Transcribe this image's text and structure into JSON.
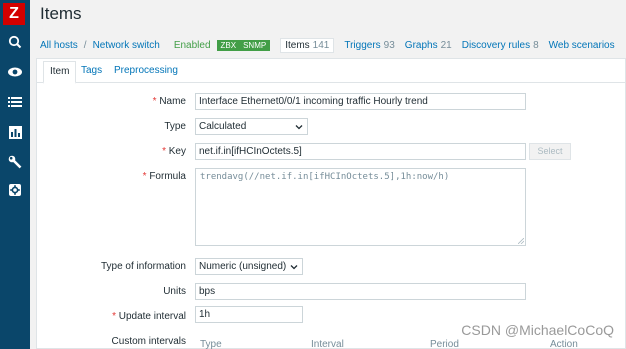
{
  "app": {
    "logo_letter": "Z",
    "page_title": "Items"
  },
  "sidebar": {
    "icons": [
      "search-icon",
      "eye-icon",
      "list-icon",
      "chart-icon",
      "wrench-icon",
      "gear-icon"
    ]
  },
  "breadcrumbs": {
    "all_hosts": "All hosts",
    "host": "Network switch",
    "status": "Enabled",
    "badges": [
      "ZBX",
      "SNMP"
    ],
    "tabs": [
      {
        "label": "Items",
        "count": "141",
        "active": true
      },
      {
        "label": "Triggers",
        "count": "93"
      },
      {
        "label": "Graphs",
        "count": "21"
      },
      {
        "label": "Discovery rules",
        "count": "8"
      },
      {
        "label": "Web scenarios",
        "count": ""
      }
    ]
  },
  "form_tabs": [
    "Item",
    "Tags",
    "Preprocessing"
  ],
  "form": {
    "name": {
      "label": "Name",
      "value": "Interface Ethernet0/0/1 incoming traffic Hourly trend"
    },
    "type": {
      "label": "Type",
      "value": "Calculated"
    },
    "key": {
      "label": "Key",
      "value": "net.if.in[ifHCInOctets.5]",
      "button": "Select"
    },
    "formula": {
      "label": "Formula",
      "value": "trendavg(//net.if.in[ifHCInOctets.5],1h:now/h)"
    },
    "type_of_information": {
      "label": "Type of information",
      "value": "Numeric (unsigned)"
    },
    "units": {
      "label": "Units",
      "value": "bps"
    },
    "update_interval": {
      "label": "Update interval",
      "value": "1h"
    },
    "custom_intervals": {
      "label": "Custom intervals",
      "columns": [
        "Type",
        "Interval",
        "Period",
        "Action"
      ]
    }
  },
  "watermark": "CSDN @MichaelCoCoQ",
  "colors": {
    "sidebar": "#0a466a",
    "link": "#0275b8",
    "enabled": "#429e47",
    "required": "#e33734"
  }
}
